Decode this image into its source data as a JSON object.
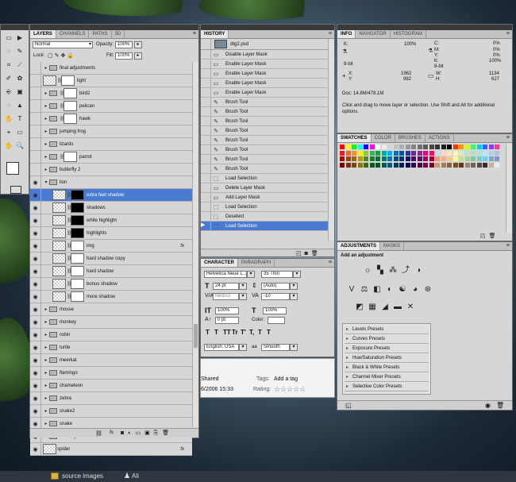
{
  "layers_panel": {
    "tabs": [
      "LAYERS",
      "CHANNELS",
      "PATHS",
      "3D"
    ],
    "blend_mode": "Normal",
    "opacity_label": "Opacity:",
    "opacity_value": "100%",
    "lock_label": "Lock:",
    "fill_label": "Fill:",
    "fill_value": "100%",
    "rows": [
      {
        "name": "final adjustments",
        "type": "group",
        "eye": false,
        "indent": 0,
        "mask": ""
      },
      {
        "name": "light",
        "type": "layer",
        "eye": false,
        "indent": 0,
        "mask": "white"
      },
      {
        "name": "bird2",
        "type": "group",
        "eye": false,
        "indent": 0,
        "mask": "white"
      },
      {
        "name": "pelican",
        "type": "group",
        "eye": false,
        "indent": 0,
        "mask": "white"
      },
      {
        "name": "hawk",
        "type": "group",
        "eye": false,
        "indent": 0,
        "mask": "white"
      },
      {
        "name": "jumping frog",
        "type": "group",
        "eye": false,
        "indent": 0,
        "mask": ""
      },
      {
        "name": "lizards",
        "type": "group",
        "eye": false,
        "indent": 0,
        "mask": ""
      },
      {
        "name": "parrot",
        "type": "group",
        "eye": false,
        "indent": 0,
        "mask": "white"
      },
      {
        "name": "butterfly 2",
        "type": "group",
        "eye": false,
        "indent": 0,
        "mask": ""
      },
      {
        "name": "lion",
        "type": "group-open",
        "eye": true,
        "indent": 0,
        "mask": ""
      },
      {
        "name": "extra feet shadow",
        "type": "layer",
        "eye": true,
        "indent": 1,
        "mask": "black",
        "selected": true
      },
      {
        "name": "shadows",
        "type": "layer",
        "eye": true,
        "indent": 1,
        "mask": "black"
      },
      {
        "name": "white highlight",
        "type": "layer",
        "eye": true,
        "indent": 1,
        "mask": "black"
      },
      {
        "name": "highlights",
        "type": "layer",
        "eye": true,
        "indent": 1,
        "mask": "black"
      },
      {
        "name": "img",
        "type": "layer",
        "eye": true,
        "indent": 1,
        "mask": "white",
        "fx": "fx"
      },
      {
        "name": "hard shadow copy",
        "type": "layer",
        "eye": true,
        "indent": 1,
        "mask": "white"
      },
      {
        "name": "hard shadow",
        "type": "layer",
        "eye": true,
        "indent": 1,
        "mask": "white"
      },
      {
        "name": "bonus shadow",
        "type": "layer",
        "eye": true,
        "indent": 1,
        "mask": "white"
      },
      {
        "name": "more shadow",
        "type": "layer",
        "eye": true,
        "indent": 1,
        "mask": "white"
      },
      {
        "name": "mouse",
        "type": "group",
        "eye": true,
        "indent": 0,
        "mask": ""
      },
      {
        "name": "monkey",
        "type": "group",
        "eye": true,
        "indent": 0,
        "mask": ""
      },
      {
        "name": "robin",
        "type": "group",
        "eye": true,
        "indent": 0,
        "mask": ""
      },
      {
        "name": "turtle",
        "type": "group",
        "eye": true,
        "indent": 0,
        "mask": ""
      },
      {
        "name": "meerkat",
        "type": "group",
        "eye": true,
        "indent": 0,
        "mask": ""
      },
      {
        "name": "flamingo",
        "type": "group",
        "eye": true,
        "indent": 0,
        "mask": ""
      },
      {
        "name": "chameleon",
        "type": "group",
        "eye": true,
        "indent": 0,
        "mask": ""
      },
      {
        "name": "zebra",
        "type": "group",
        "eye": true,
        "indent": 0,
        "mask": ""
      },
      {
        "name": "snake2",
        "type": "group",
        "eye": true,
        "indent": 0,
        "mask": ""
      },
      {
        "name": "snake",
        "type": "group",
        "eye": true,
        "indent": 0,
        "mask": ""
      },
      {
        "name": "butterfly",
        "type": "group",
        "eye": true,
        "indent": 0,
        "mask": ""
      },
      {
        "name": "spider",
        "type": "layer",
        "eye": true,
        "indent": 0,
        "mask": "",
        "fx": "fx"
      }
    ],
    "footer_fx": "fx."
  },
  "history_panel": {
    "tab": "HISTORY",
    "doc_name": "dtg2.psd",
    "rows": [
      {
        "label": "Disable Layer Mask",
        "icon": "mask"
      },
      {
        "label": "Enable Layer Mask",
        "icon": "mask"
      },
      {
        "label": "Enable Layer Mask",
        "icon": "mask"
      },
      {
        "label": "Enable Layer Mask",
        "icon": "mask"
      },
      {
        "label": "Enable Layer Mask",
        "icon": "mask"
      },
      {
        "label": "Brush Tool",
        "icon": "brush"
      },
      {
        "label": "Brush Tool",
        "icon": "brush"
      },
      {
        "label": "Brush Tool",
        "icon": "brush"
      },
      {
        "label": "Brush Tool",
        "icon": "brush"
      },
      {
        "label": "Brush Tool",
        "icon": "brush"
      },
      {
        "label": "Brush Tool",
        "icon": "brush"
      },
      {
        "label": "Brush Tool",
        "icon": "brush"
      },
      {
        "label": "Brush Tool",
        "icon": "brush"
      },
      {
        "label": "Load Selection",
        "icon": "selection"
      },
      {
        "label": "Delete Layer Mask",
        "icon": "mask"
      },
      {
        "label": "Add Layer Mask",
        "icon": "mask"
      },
      {
        "label": "Load Selection",
        "icon": "selection"
      },
      {
        "label": "Deselect",
        "icon": "selection"
      },
      {
        "label": "Load Selection",
        "icon": "selection",
        "selected": true
      }
    ]
  },
  "character_panel": {
    "tabs": [
      "CHARACTER",
      "PARAGRAPH"
    ],
    "font_family": "Helvetica Neue L...",
    "font_style": "35 Thin",
    "font_size": "24 pt",
    "leading": "(Auto)",
    "kerning": "Metrics",
    "tracking": "-10",
    "vscale": "100%",
    "hscale": "100%",
    "baseline": "0 pt",
    "color_label": "Color:",
    "type_buttons": [
      "T",
      "T",
      "TT",
      "Tr",
      "T'",
      "T,",
      "T",
      "T"
    ],
    "language": "English: USA",
    "antialias_prefix": "aa",
    "antialias": "Smooth"
  },
  "bridge_strip": {
    "shared": "Shared",
    "date": "6/2006 15:33",
    "tags_label": "Tags:",
    "tags_value": "Add a tag",
    "rating_label": "Rating:",
    "stars": "☆☆☆☆☆"
  },
  "info_panel": {
    "tabs": [
      "INFO",
      "NAVIGATOR",
      "HISTOGRAM"
    ],
    "k1_label": "K:",
    "k1_value": "100%",
    "c_label": "C:",
    "c_value": "0%",
    "m_label": "M:",
    "m_value": "0%",
    "y_label": "Y:",
    "y_value": "0%",
    "k2_label": "K:",
    "k2_value": "100%",
    "bits1": "8-bit",
    "bits2": "8-bit",
    "x_label": "X:",
    "x_value": "1962",
    "yy_label": "Y:",
    "yy_value": "982",
    "w_label": "W:",
    "w_value": "1134",
    "h_label": "H:",
    "h_value": "627",
    "doc": "Doc: 14.8M/478.1M",
    "hint": "Click and drag to move layer or selection.  Use Shift and Alt for additional options."
  },
  "swatches_panel": {
    "tabs": [
      "SWATCHES",
      "COLOR",
      "BRUSHES",
      "ACTIONS"
    ],
    "row1": [
      "#ff0000",
      "#ffff00",
      "#00ff00",
      "#00ffff",
      "#0000ff",
      "#ff00ff",
      "#ffffff",
      "#ebebeb",
      "#d6d6d6",
      "#c2c2c2",
      "#adadad",
      "#999999",
      "#858585",
      "#707070",
      "#5c5c5c",
      "#474747",
      "#333333",
      "#1f1f1f",
      "#000000",
      "#ff3300",
      "#ff9900",
      "#ccff00",
      "#33ff66",
      "#00ccff",
      "#3366ff",
      "#9933ff",
      "#ff3399"
    ],
    "row2": [
      "#ed1c24",
      "#f26522",
      "#f7941d",
      "#fff200",
      "#8dc63f",
      "#39b54a",
      "#00a651",
      "#00a99d",
      "#00aeef",
      "#0072bc",
      "#0054a6",
      "#2e3192",
      "#662d91",
      "#92278f",
      "#ec008c",
      "#ed145b",
      "#c4ddf0",
      "#fbd7c4",
      "#fce5b7",
      "#fff9b2",
      "#d9ecb9",
      "#bfe2bd",
      "#b4dfc4",
      "#b2e1df",
      "#b3e4f8",
      "#b2cfea",
      "#b2bfe0"
    ],
    "row3": [
      "#9e0b0f",
      "#a0410d",
      "#a36209",
      "#aba000",
      "#598527",
      "#1a7b30",
      "#007236",
      "#00746b",
      "#0076a3",
      "#004a80",
      "#003471",
      "#1b1464",
      "#440e62",
      "#630460",
      "#9e005d",
      "#9e0039",
      "#f69679",
      "#f9ad81",
      "#fdc68a",
      "#fff79a",
      "#c4df9b",
      "#a3d39c",
      "#82ca9d",
      "#7accc8",
      "#6dcff6",
      "#7da7d9",
      "#8393ca"
    ],
    "row4": [
      "#790000",
      "#7b2e00",
      "#7d4900",
      "#827b00",
      "#406618",
      "#005e20",
      "#005826",
      "#005952",
      "#005b7f",
      "#003663",
      "#002157",
      "#0d004c",
      "#32004b",
      "#4b0049",
      "#7b0046",
      "#7a0026",
      "#c69c6d",
      "#a67c52",
      "#8c6239",
      "#754c24",
      "#603913",
      "#998675",
      "#736357",
      "#534741",
      "#362f2d",
      "#c7b299",
      "#ebebeb"
    ]
  },
  "adjustments_panel": {
    "tabs": [
      "ADJUSTMENTS",
      "MASKS"
    ],
    "heading": "Add an adjustment",
    "icons_row1": [
      "☼",
      "▚",
      "⁂",
      "⤴",
      "◑"
    ],
    "icons_row2": [
      "V",
      "⚖",
      "◧",
      "◐",
      "☯",
      "◕",
      "⊛"
    ],
    "icons_row3": [
      "◩",
      "▦",
      "◢",
      "▬",
      "✕"
    ],
    "presets": [
      "Levels Presets",
      "Curves Presets",
      "Exposure Presets",
      "Hue/Saturation Presets",
      "Black & White Presets",
      "Channel Mixer Presets",
      "Selective Color Presets"
    ]
  },
  "tools": [
    "▭",
    "▶",
    "◌",
    "✎",
    "⌗",
    "⟋",
    "✐",
    "✿",
    "⎆",
    "▣",
    "◌",
    "▲",
    "✋",
    "T",
    "⌖",
    "▭",
    "✋",
    "🔍"
  ],
  "taskbar": {
    "folder_label": "source images",
    "user_label": "Ali"
  },
  "colors": {
    "panel": "#d6d6d6",
    "selected": "#4a7bd0",
    "tab_bar": "#c2c2c2"
  }
}
